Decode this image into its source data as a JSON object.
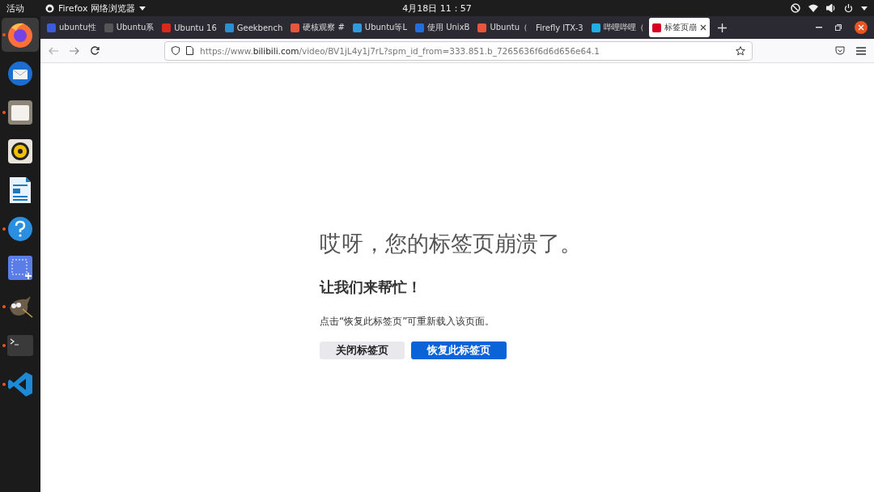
{
  "top_bar": {
    "activities": "活动",
    "app_menu": "Firefox 网络浏览器",
    "clock": "4月18日  11：57"
  },
  "dock": [
    {
      "kind": "browser",
      "running": true,
      "selected": true
    },
    {
      "kind": "mail",
      "running": false,
      "selected": false
    },
    {
      "kind": "files",
      "running": true,
      "selected": false
    },
    {
      "kind": "music",
      "running": false,
      "selected": false
    },
    {
      "kind": "document",
      "running": false,
      "selected": false
    },
    {
      "kind": "help",
      "running": true,
      "selected": false
    },
    {
      "kind": "screenshot",
      "running": false,
      "selected": false
    },
    {
      "kind": "painter",
      "running": true,
      "selected": false
    },
    {
      "kind": "terminal",
      "running": true,
      "selected": false
    },
    {
      "kind": "editor",
      "running": true,
      "selected": false
    }
  ],
  "tabs": [
    {
      "title": "ubuntu性",
      "color": "#3b5bdb",
      "selected": false
    },
    {
      "title": "Ubuntu系",
      "color": "#555555",
      "selected": false
    },
    {
      "title": "Ubuntu 16",
      "color": "#d9291c",
      "selected": false
    },
    {
      "title": "Geekbench",
      "color": "#2b8fd6",
      "selected": false
    },
    {
      "title": "硬核观察 #",
      "color": "#e8553a",
      "selected": false
    },
    {
      "title": "Ubuntu等L",
      "color": "#2d9be0",
      "selected": false
    },
    {
      "title": "使用 UnixB",
      "color": "#1f6fe0",
      "selected": false
    },
    {
      "title": "Ubuntu（",
      "color": "#e8553a",
      "selected": false
    },
    {
      "title": "Firefly ITX-3",
      "selected": false
    },
    {
      "title": "哔哩哔哩（",
      "color": "#23ade5",
      "selected": false
    },
    {
      "title": "标签页崩",
      "color": "#d70022",
      "selected": true
    }
  ],
  "url": "https://www.**bilibili.com**/video/BV1jL4y1j7rL?spm_id_from=333.851.b_7265636f6d6d656e64.1",
  "page": {
    "title": "哎呀，您的标签页崩溃了。",
    "heading": "让我们来帮忙！",
    "message": "点击“恢复此标签页”可重新载入该页面。",
    "buttons": [
      {
        "label": "关闭标签页",
        "kind": "secondary"
      },
      {
        "label": "恢复此标签页",
        "kind": "primary"
      }
    ]
  }
}
